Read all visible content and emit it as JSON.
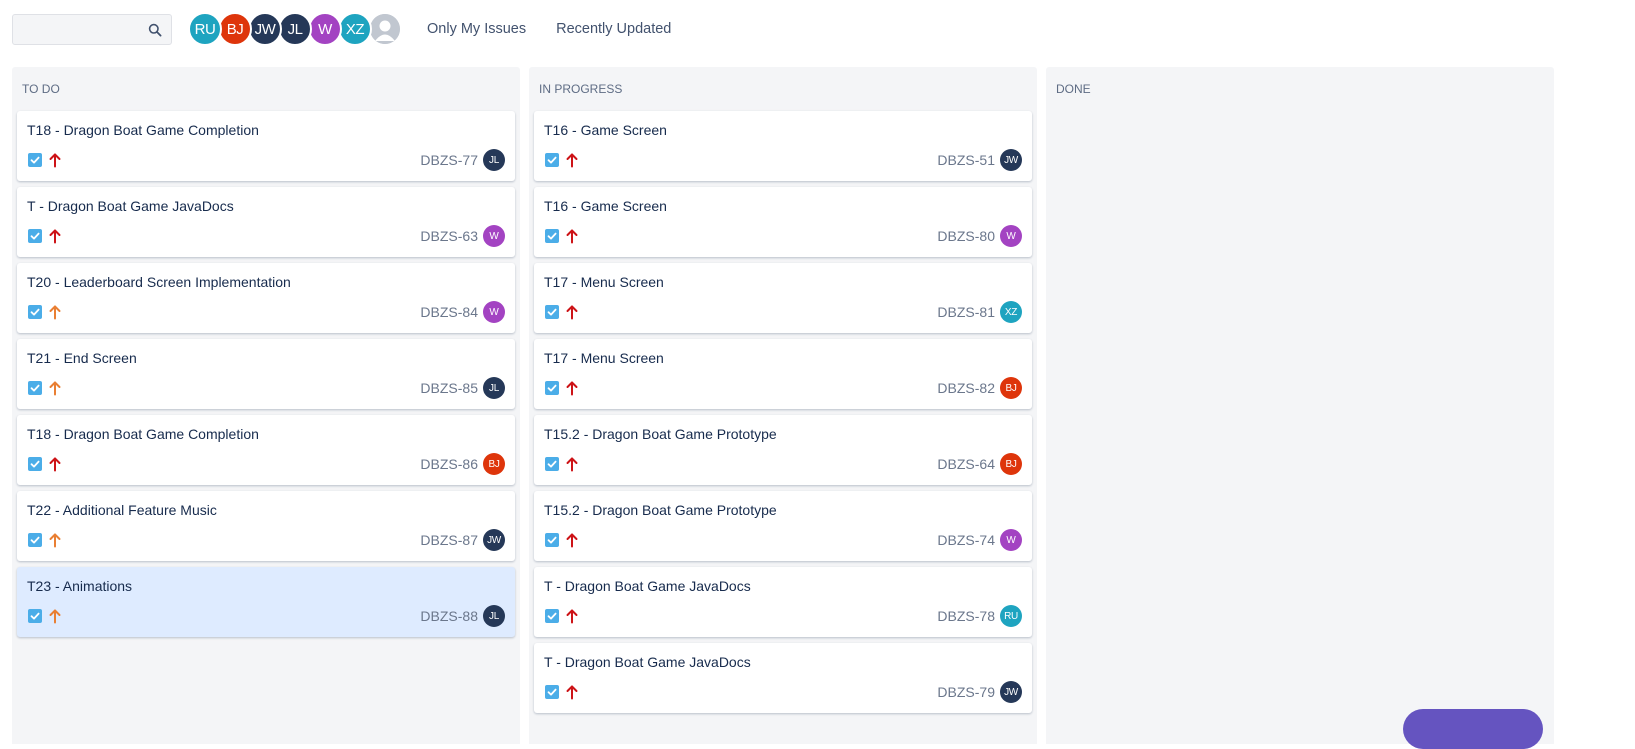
{
  "colors": {
    "priority_high": "#cd1317",
    "priority_medium": "#e97f33",
    "task_type": "#4bade8",
    "RU": "#1ea4c0",
    "BJ": "#de350b",
    "JW": "#253858",
    "JL": "#253858",
    "W": "#a343c2",
    "XZ": "#1ea4c0"
  },
  "toolbar": {
    "search": {
      "value": "",
      "placeholder": "",
      "icon": "search-icon"
    },
    "assignees": [
      "RU",
      "BJ",
      "JW",
      "JL",
      "W",
      "XZ"
    ],
    "unassigned_icon": "user-placeholder-icon",
    "filters": {
      "only_my_issues": "Only My Issues",
      "recently_updated": "Recently Updated"
    }
  },
  "columns": [
    {
      "title": "TO DO",
      "cards": [
        {
          "summary": "T18 - Dragon Boat Game Completion",
          "key": "DBZS-77",
          "priority": "high",
          "assignee": "JL"
        },
        {
          "summary": "T - Dragon Boat Game JavaDocs",
          "key": "DBZS-63",
          "priority": "high",
          "assignee": "W"
        },
        {
          "summary": "T20 - Leaderboard Screen Implementation",
          "key": "DBZS-84",
          "priority": "medium",
          "assignee": "W"
        },
        {
          "summary": "T21 - End Screen",
          "key": "DBZS-85",
          "priority": "medium",
          "assignee": "JL"
        },
        {
          "summary": "T18 - Dragon Boat Game Completion",
          "key": "DBZS-86",
          "priority": "high",
          "assignee": "BJ"
        },
        {
          "summary": "T22 - Additional Feature Music",
          "key": "DBZS-87",
          "priority": "medium",
          "assignee": "JW"
        },
        {
          "summary": "T23 - Animations",
          "key": "DBZS-88",
          "priority": "medium",
          "assignee": "JL",
          "selected": true
        }
      ]
    },
    {
      "title": "IN PROGRESS",
      "cards": [
        {
          "summary": "T16 - Game Screen",
          "key": "DBZS-51",
          "priority": "high",
          "assignee": "JW"
        },
        {
          "summary": "T16 - Game Screen",
          "key": "DBZS-80",
          "priority": "high",
          "assignee": "W"
        },
        {
          "summary": "T17 - Menu Screen",
          "key": "DBZS-81",
          "priority": "high",
          "assignee": "XZ"
        },
        {
          "summary": "T17 - Menu Screen",
          "key": "DBZS-82",
          "priority": "high",
          "assignee": "BJ"
        },
        {
          "summary": "T15.2 - Dragon Boat Game Prototype",
          "key": "DBZS-64",
          "priority": "high",
          "assignee": "BJ"
        },
        {
          "summary": "T15.2 - Dragon Boat Game Prototype",
          "key": "DBZS-74",
          "priority": "high",
          "assignee": "W"
        },
        {
          "summary": "T - Dragon Boat Game JavaDocs",
          "key": "DBZS-78",
          "priority": "high",
          "assignee": "RU"
        },
        {
          "summary": "T - Dragon Boat Game JavaDocs",
          "key": "DBZS-79",
          "priority": "high",
          "assignee": "JW"
        }
      ]
    },
    {
      "title": "DONE",
      "cards": []
    }
  ]
}
